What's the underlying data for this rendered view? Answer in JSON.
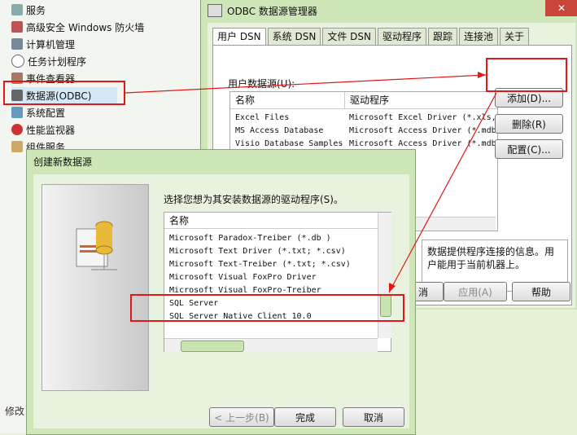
{
  "admin_tools": {
    "items": [
      {
        "label": "服务",
        "icon": "services-icon"
      },
      {
        "label": "高级安全 Windows 防火墙",
        "icon": "firewall-icon"
      },
      {
        "label": "计算机管理",
        "icon": "computer-management-icon"
      },
      {
        "label": "任务计划程序",
        "icon": "clock-icon"
      },
      {
        "label": "事件查看器",
        "icon": "event-viewer-icon"
      },
      {
        "label": "数据源(ODBC)",
        "icon": "odbc-icon"
      },
      {
        "label": "系统配置",
        "icon": "system-config-icon"
      },
      {
        "label": "性能监视器",
        "icon": "performance-icon"
      },
      {
        "label": "组件服务",
        "icon": "component-services-icon"
      }
    ],
    "status_text": "修改"
  },
  "odbc_window": {
    "title": "ODBC 数据源管理器",
    "tabs": [
      "用户 DSN",
      "系统 DSN",
      "文件 DSN",
      "驱动程序",
      "跟踪",
      "连接池",
      "关于"
    ],
    "user_ds_label": "用户数据源(U):",
    "columns": [
      "名称",
      "驱动程序"
    ],
    "rows": [
      {
        "name": "Excel Files",
        "driver": "Microsoft Excel Driver (*.xls,"
      },
      {
        "name": "MS Access Database",
        "driver": "Microsoft Access Driver (*.mdb"
      },
      {
        "name": "Visio Database Samples",
        "driver": "Microsoft Access Driver (*.mdb"
      }
    ],
    "add_button": "添加(D)...",
    "delete_button": "删除(R)",
    "config_button": "配置(C)...",
    "info_text": "数据提供程序连接的信息。用户能用于当前机器上。",
    "cancel_partial": "消",
    "apply_button": "应用(A)",
    "help_button": "帮助"
  },
  "create_dialog": {
    "title": "创建新数据源",
    "prompt": "选择您想为其安装数据源的驱动程序(S)。",
    "column": "名称",
    "drivers": [
      "Microsoft Paradox-Treiber (*.db )",
      "Microsoft Text Driver (*.txt; *.csv)",
      "Microsoft Text-Treiber (*.txt; *.csv)",
      "Microsoft Visual FoxPro Driver",
      "Microsoft Visual FoxPro-Treiber",
      "SQL Server",
      "SQL Server Native Client 10.0"
    ],
    "back_button": "< 上一步(B)",
    "finish_button": "完成",
    "cancel_button": "取消"
  },
  "colors": {
    "highlight": "#e01818",
    "window_bg": "#cfe6b9"
  }
}
